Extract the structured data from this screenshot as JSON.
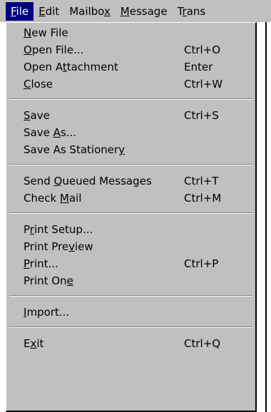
{
  "menubar": [
    {
      "pre": "",
      "key": "F",
      "post": "ile"
    },
    {
      "pre": "",
      "key": "E",
      "post": "dit"
    },
    {
      "pre": "Mailbo",
      "key": "x",
      "post": ""
    },
    {
      "pre": "",
      "key": "M",
      "post": "essage"
    },
    {
      "pre": "T",
      "key": "r",
      "post": "ans"
    }
  ],
  "menu": {
    "items": [
      {
        "pre": "",
        "key": "N",
        "post": "ew File",
        "shortcut": ""
      },
      {
        "pre": "",
        "key": "O",
        "post": "pen File...",
        "shortcut": "Ctrl+O"
      },
      {
        "pre": "Open A",
        "key": "t",
        "post": "tachment",
        "shortcut": "Enter"
      },
      {
        "pre": "",
        "key": "C",
        "post": "lose",
        "shortcut": "Ctrl+W"
      },
      {
        "pre": "",
        "key": "S",
        "post": "ave",
        "shortcut": "Ctrl+S"
      },
      {
        "pre": "Save ",
        "key": "A",
        "post": "s...",
        "shortcut": ""
      },
      {
        "pre": "Save As Stationer",
        "key": "y",
        "post": "",
        "shortcut": ""
      },
      {
        "pre": "Send ",
        "key": "Q",
        "post": "ueued Messages",
        "shortcut": "Ctrl+T"
      },
      {
        "pre": "Check ",
        "key": "M",
        "post": "ail",
        "shortcut": "Ctrl+M"
      },
      {
        "pre": "P",
        "key": "r",
        "post": "int Setup...",
        "shortcut": ""
      },
      {
        "pre": "Print Pre",
        "key": "v",
        "post": "iew",
        "shortcut": ""
      },
      {
        "pre": "",
        "key": "P",
        "post": "rint...",
        "shortcut": "Ctrl+P"
      },
      {
        "pre": "Print On",
        "key": "e",
        "post": "",
        "shortcut": ""
      },
      {
        "pre": "",
        "key": "I",
        "post": "mport...",
        "shortcut": ""
      },
      {
        "pre": "E",
        "key": "x",
        "post": "it",
        "shortcut": "Ctrl+Q"
      }
    ]
  }
}
